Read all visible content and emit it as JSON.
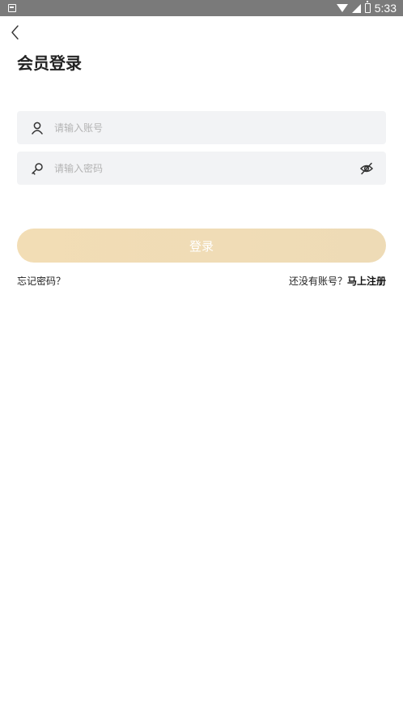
{
  "status_bar": {
    "time": "5:33"
  },
  "header": {
    "title": "会员登录"
  },
  "form": {
    "account_placeholder": "请输入账号",
    "password_placeholder": "请输入密码",
    "account_value": "",
    "password_value": ""
  },
  "login_button": {
    "label": "登录"
  },
  "links": {
    "forgot_password": "忘记密码？",
    "no_account": "还没有账号？",
    "register": "马上注册"
  },
  "icons": {
    "status_left": "notification-icon",
    "wifi": "wifi-icon",
    "signal": "signal-icon",
    "battery": "battery-icon",
    "back": "chevron-left-icon",
    "user": "user-icon",
    "key": "key-icon",
    "eye_off": "eye-off-icon"
  },
  "colors": {
    "status_bar": "#7a7a7a",
    "field_bg": "#f2f3f5",
    "button_gradient_start": "#f2ddb5",
    "button_gradient_end": "#eedbb6",
    "button_text": "#ffffff",
    "placeholder": "#b3b3b3"
  }
}
